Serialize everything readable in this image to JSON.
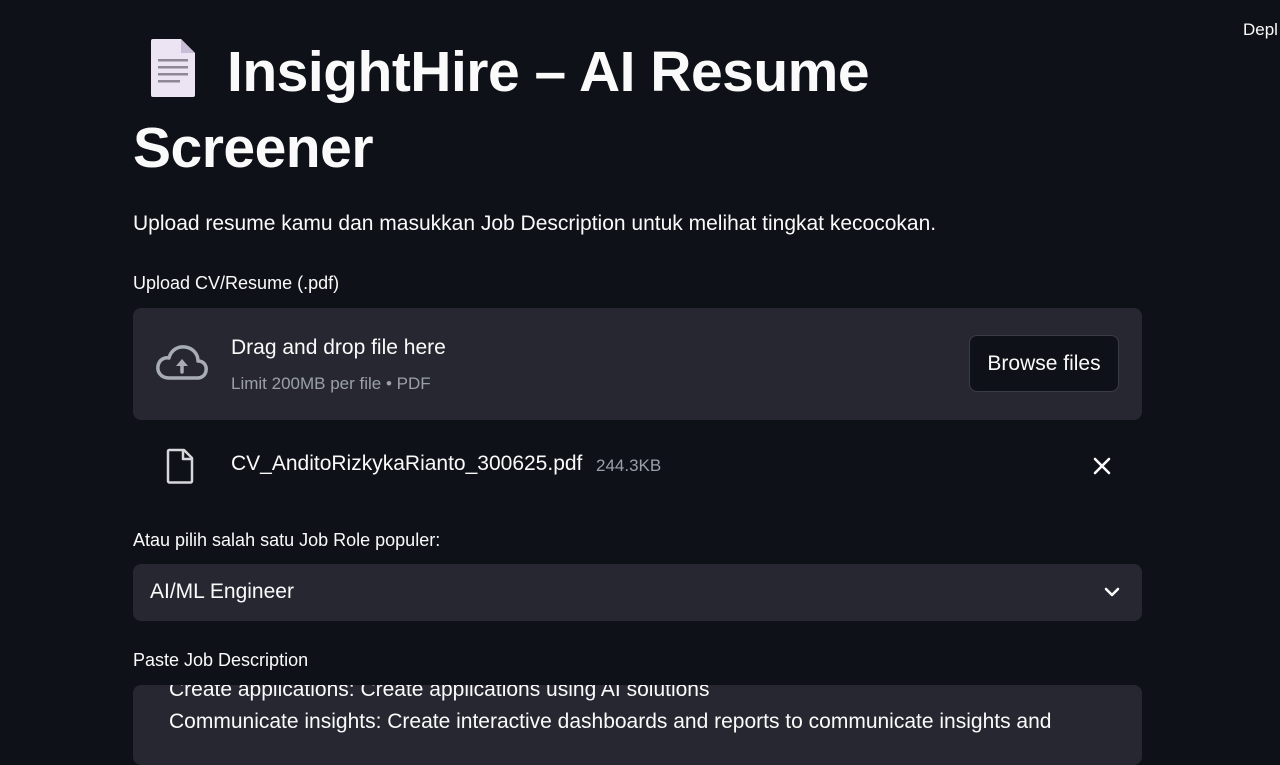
{
  "header": {
    "deploy_label": "Depl"
  },
  "page": {
    "title_line1": "InsightHire – AI Resume",
    "title_line2": "Screener",
    "title_icon": "document-icon",
    "subtitle": "Upload resume kamu dan masukkan Job Description untuk melihat tingkat kecocokan."
  },
  "uploader": {
    "label": "Upload CV/Resume (.pdf)",
    "drop_text": "Drag and drop file here",
    "limit_text": "Limit 200MB per file • PDF",
    "browse_label": "Browse files",
    "file": {
      "name": "CV_AnditoRizkykaRianto_300625.pdf",
      "size": "244.3KB"
    }
  },
  "job_role": {
    "label": "Atau pilih salah satu Job Role populer:",
    "selected": "AI/ML Engineer"
  },
  "job_description": {
    "label": "Paste Job Description",
    "lines": [
      "Create applications: Create applications using AI solutions",
      "Communicate insights: Create interactive dashboards and reports to communicate insights and"
    ]
  },
  "colors": {
    "background": "#0e1117",
    "surface": "#262730",
    "text": "#fafafa",
    "muted": "#9aa0ab"
  }
}
